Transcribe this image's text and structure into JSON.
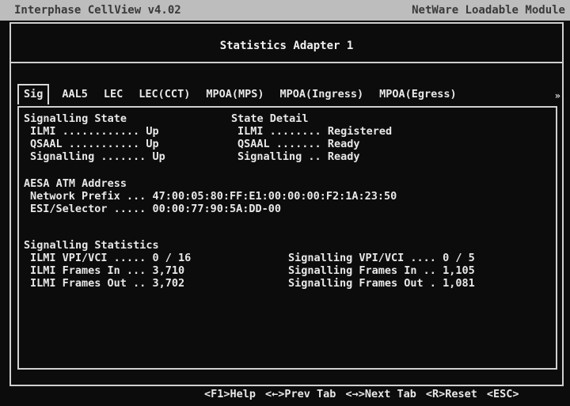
{
  "titlebar": {
    "app": "Interphase CellView v4.02",
    "module": "NetWare Loadable Module"
  },
  "header": {
    "title": "Statistics Adapter 1"
  },
  "tabs": [
    {
      "label": "Sig",
      "active": true
    },
    {
      "label": "AAL5"
    },
    {
      "label": "LEC"
    },
    {
      "label": "LEC(CCT)"
    },
    {
      "label": "MPOA(MPS)"
    },
    {
      "label": "MPOA(Ingress)"
    },
    {
      "label": "MPOA(Egress)"
    }
  ],
  "tab_more_glyph": "»",
  "signalling_state": {
    "heading": "Signalling State",
    "rows": [
      {
        "label": "ILMI ............",
        "value": "Up"
      },
      {
        "label": "QSAAL ...........",
        "value": "Up"
      },
      {
        "label": "Signalling .......",
        "value": "Up"
      }
    ]
  },
  "state_detail": {
    "heading": "State Detail",
    "rows": [
      {
        "label": "ILMI ........",
        "value": "Registered"
      },
      {
        "label": "QSAAL .......",
        "value": "Ready"
      },
      {
        "label": "Signalling ..",
        "value": "Ready"
      }
    ]
  },
  "aesa": {
    "heading": "AESA ATM Address",
    "rows": [
      {
        "label": "Network Prefix ...",
        "value": "47:00:05:80:FF:E1:00:00:00:F2:1A:23:50"
      },
      {
        "label": "ESI/Selector .....",
        "value": "00:00:77:90:5A:DD-00"
      }
    ]
  },
  "signalling_stats": {
    "heading": "Signalling Statistics",
    "left": [
      {
        "label": "ILMI VPI/VCI .....",
        "value": "0 / 16"
      },
      {
        "label": "ILMI Frames In ...",
        "value": "3,710"
      },
      {
        "label": "ILMI Frames Out ..",
        "value": "3,702"
      }
    ],
    "right": [
      {
        "label": "Signalling VPI/VCI ....",
        "value": "0 / 5"
      },
      {
        "label": "Signalling Frames In ..",
        "value": "1,105"
      },
      {
        "label": "Signalling Frames Out .",
        "value": "1,081"
      }
    ]
  },
  "footer": {
    "help": "<F1>Help",
    "prev": "<←>Prev Tab",
    "next": "<→>Next Tab",
    "reset": "<R>Reset",
    "esc": "<ESC>"
  }
}
